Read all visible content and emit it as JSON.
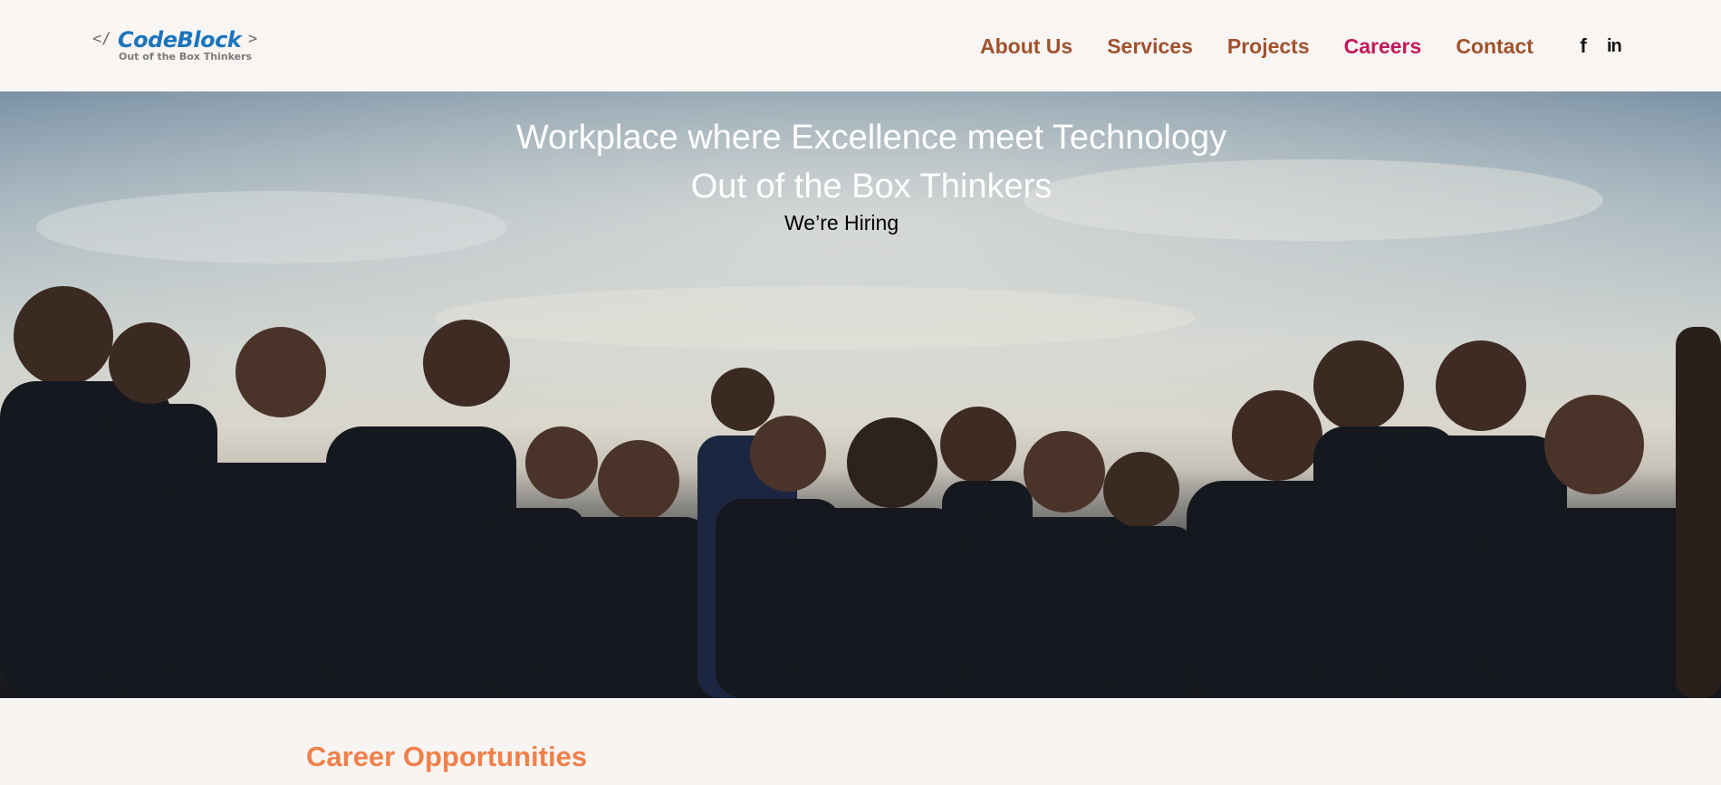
{
  "logo": {
    "open_bracket": "</",
    "brand": "CodeBlock",
    "close_bracket": ">",
    "tagline": "Out of the Box Thinkers"
  },
  "nav": {
    "items": [
      {
        "label": "About Us",
        "active": false
      },
      {
        "label": "Services",
        "active": false
      },
      {
        "label": "Projects",
        "active": false
      },
      {
        "label": "Careers",
        "active": true
      },
      {
        "label": "Contact",
        "active": false
      }
    ]
  },
  "social": {
    "facebook": "f",
    "linkedin": "in"
  },
  "hero": {
    "title_line1": "Workplace where Excellence meet Technology",
    "title_line2": "Out of the Box Thinkers",
    "subtitle": "We’re Hiring",
    "image_description": "team-photo"
  },
  "career_section": {
    "heading": "Career Opportunities"
  },
  "colors": {
    "nav_text": "#a0522d",
    "nav_active": "#c2185b",
    "brand_blue": "#1c75bc",
    "career_heading": "#f0804a"
  }
}
